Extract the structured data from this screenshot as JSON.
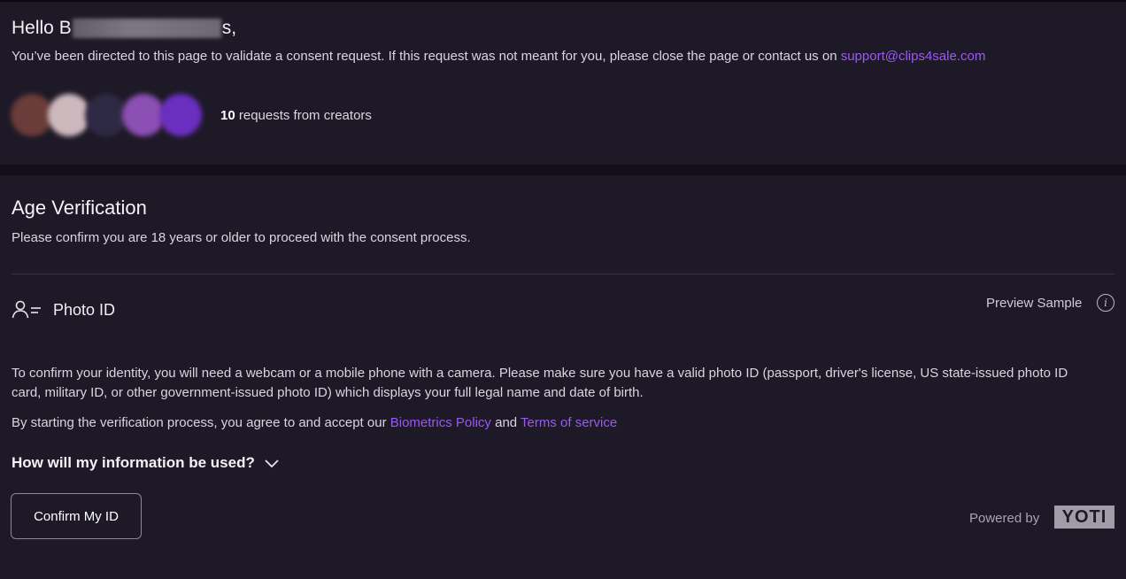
{
  "greeting": {
    "hello_prefix": "Hello B",
    "hello_suffix": "s,",
    "intro_text": "You’ve been directed to this page to validate a consent request. If this request was not meant for you, please close the page or contact us on ",
    "support_email": "support@clips4sale.com",
    "request_count": "10",
    "request_text": " requests from creators",
    "avatar_colors": [
      "#5a3a3c",
      "#c9b7bb",
      "#3a3550",
      "#8a4cb0",
      "#6a30b8"
    ]
  },
  "verification": {
    "title": "Age Verification",
    "subtitle": "Please confirm you are 18 years or older to proceed with the consent process.",
    "method_label": "Photo ID",
    "preview_label": "Preview Sample",
    "info_glyph": "i",
    "paragraph1": "To confirm your identity, you will need a webcam or a mobile phone with a camera. Please make sure you have a valid photo ID (passport, driver's license, US state-issued photo ID card, military ID, or other government-issued photo ID) which displays your full legal name and date of birth.",
    "agree_prefix": "By starting the verification process, you agree to and accept our ",
    "biometrics_link": "Biometrics Policy",
    "agree_and": " and ",
    "terms_link": "Terms of service",
    "faq_label": "How will my information be used?",
    "confirm_button": "Confirm My ID",
    "powered_by": "Powered by",
    "brand": "YOTI"
  },
  "colors": {
    "link": "#9b59f2",
    "panel": "#1e1927",
    "background": "#120f18"
  }
}
